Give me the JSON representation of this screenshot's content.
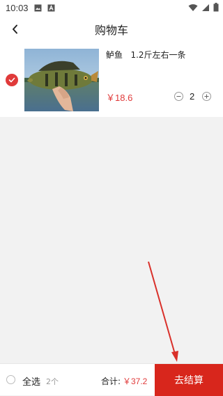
{
  "status_bar": {
    "time": "10:03"
  },
  "header": {
    "title": "购物车"
  },
  "cart": {
    "items": [
      {
        "name": "鲈鱼   1.2斤左右一条",
        "price": "￥18.6",
        "quantity": "2",
        "checked": true
      }
    ]
  },
  "footer": {
    "select_all_label": "全选",
    "selected_count": "2个",
    "total_label": "合计:",
    "total_value": "￥37.2",
    "checkout_label": "去结算"
  },
  "colors": {
    "accent": "#e03a3a",
    "checkout_bg": "#d8261c",
    "page_bg": "#f2f2f2"
  }
}
